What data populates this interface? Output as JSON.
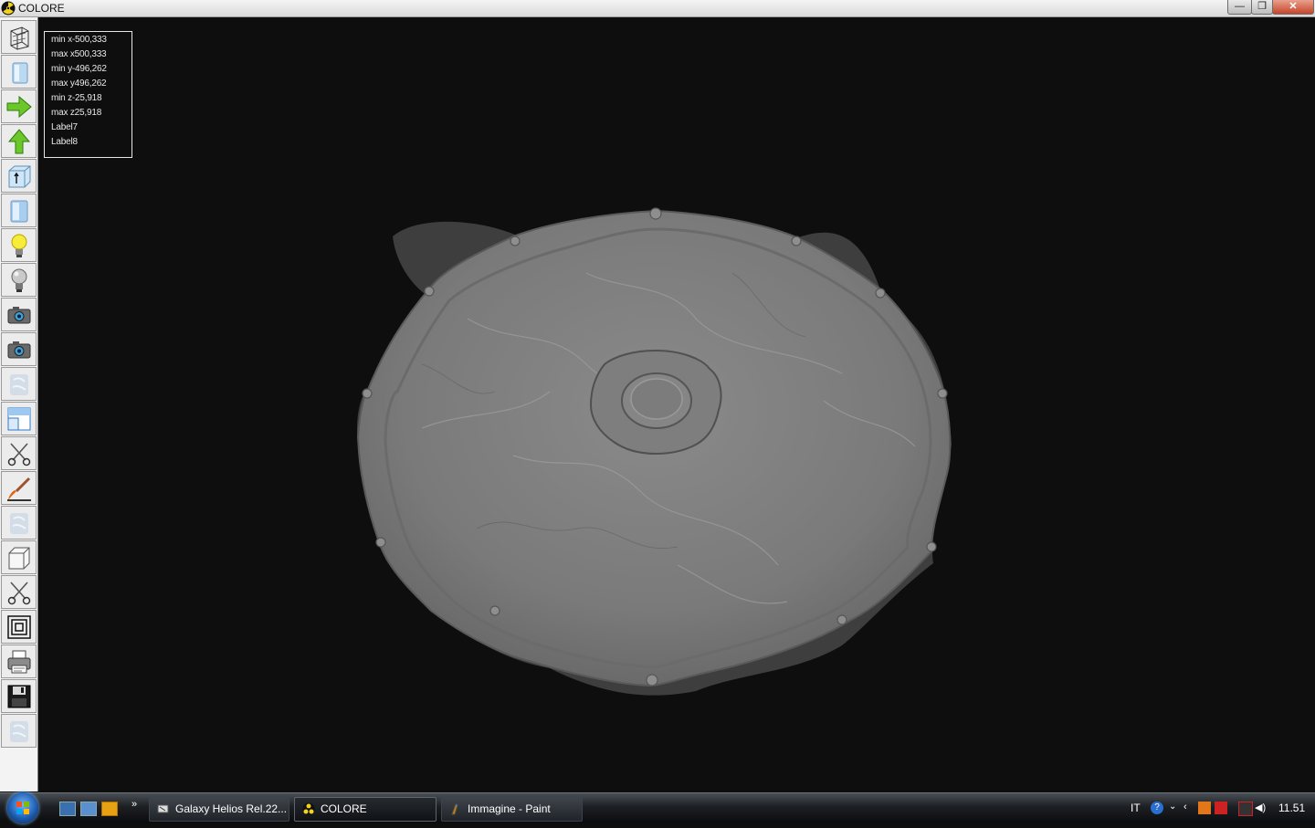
{
  "window": {
    "title": "COLORE",
    "buttons": {
      "minimize": "—",
      "restore": "❐",
      "close": "✕"
    }
  },
  "toolbar": {
    "tools": [
      {
        "name": "wireframe-view-icon"
      },
      {
        "name": "solid-view-icon"
      },
      {
        "name": "arrow-right-icon"
      },
      {
        "name": "arrow-up-icon"
      },
      {
        "name": "box-axis-icon"
      },
      {
        "name": "cylinder-icon"
      },
      {
        "name": "light-on-icon"
      },
      {
        "name": "light-off-icon"
      },
      {
        "name": "camera-icon"
      },
      {
        "name": "camera-alt-icon"
      },
      {
        "name": "texture-icon"
      },
      {
        "name": "window-view-icon"
      },
      {
        "name": "scissors-icon"
      },
      {
        "name": "brush-icon"
      },
      {
        "name": "texture-alt-icon"
      },
      {
        "name": "cube-icon"
      },
      {
        "name": "scissors-alt-icon"
      },
      {
        "name": "contour-icon"
      },
      {
        "name": "printer-icon"
      },
      {
        "name": "save-icon"
      },
      {
        "name": "texture-extra-icon"
      }
    ]
  },
  "info": {
    "lines": [
      "min x-500,333",
      "max x500,333",
      "min y-496,262",
      "max y496,262",
      "min z-25,918",
      "max z25,918",
      "Label7",
      "Label8"
    ]
  },
  "taskbar": {
    "tasks": [
      {
        "label": "Galaxy Helios  Rel.22...",
        "active": false
      },
      {
        "label": "COLORE",
        "active": true
      },
      {
        "label": "Immagine - Paint",
        "active": false
      }
    ],
    "tray": {
      "lang": "IT",
      "time": "11.51",
      "chevron": "»"
    }
  },
  "colors": {
    "viewport_bg": "#0e0e0e",
    "model": "#777777",
    "accent": "#2f8fe0"
  }
}
